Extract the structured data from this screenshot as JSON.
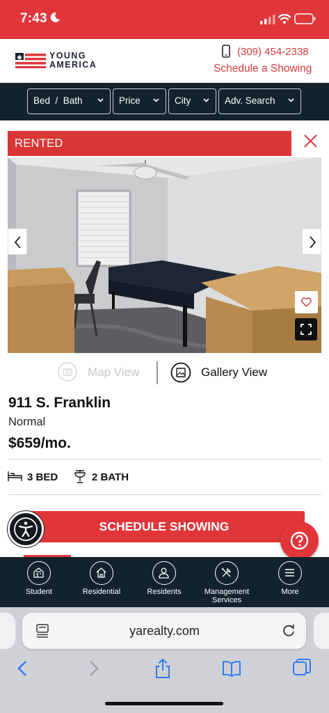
{
  "status_bar": {
    "time": "7:43",
    "icons": [
      "moon-icon",
      "cellular-signal-icon",
      "wifi-icon",
      "battery-icon"
    ],
    "color": "#e0363a"
  },
  "header": {
    "logo_line1": "YOUNG",
    "logo_line2": "AMERICA",
    "phone": "(309) 454-2338",
    "schedule_link": "Schedule a Showing"
  },
  "filters": [
    {
      "label": "Bed  /  Bath"
    },
    {
      "label": "Price"
    },
    {
      "label": "City"
    },
    {
      "label": "Adv. Search"
    }
  ],
  "listing": {
    "status_badge": "RENTED",
    "views": {
      "map": "Map View",
      "gallery": "Gallery View"
    },
    "address": "911 S. Franklin",
    "city": "Normal",
    "price": "$659/mo.",
    "beds": "3 BED",
    "baths": "2 BATH",
    "cta": "SCHEDULE SHOWING"
  },
  "bottom_nav": [
    {
      "label": "Student",
      "icon": "student-housing-icon"
    },
    {
      "label": "Residential",
      "icon": "home-icon"
    },
    {
      "label": "Residents",
      "icon": "person-icon"
    },
    {
      "label": "Management Services",
      "icon": "tools-icon"
    },
    {
      "label": "More",
      "icon": "menu-icon"
    }
  ],
  "browser": {
    "url": "yarealty.com"
  },
  "colors": {
    "brand_red": "#e0363a",
    "navy": "#12232d"
  }
}
